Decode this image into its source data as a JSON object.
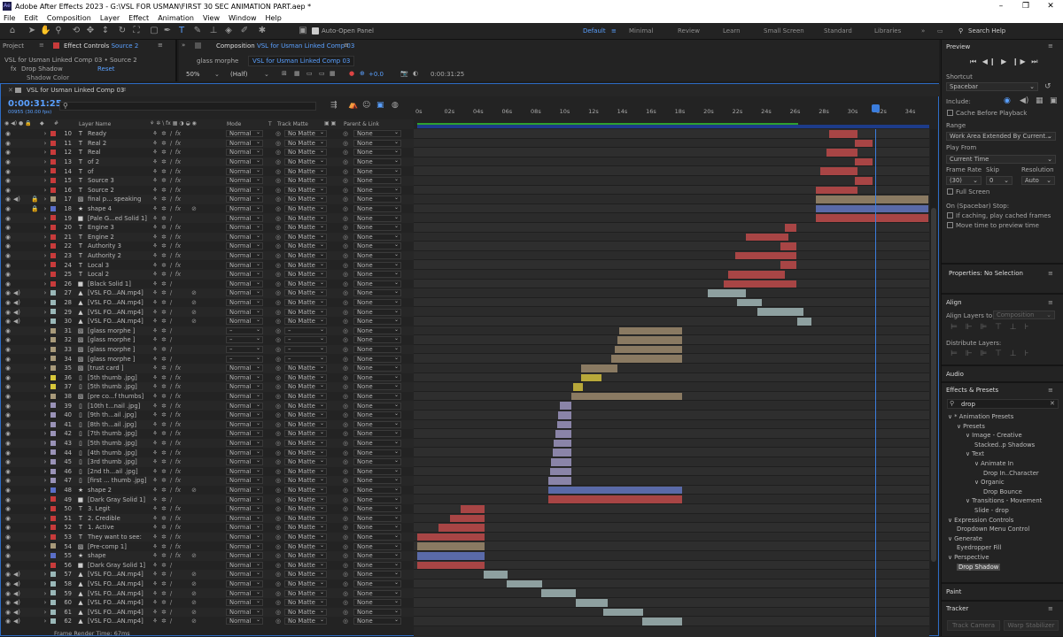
{
  "window": {
    "title": "Adobe After Effects 2023 - G:\\VSL FOR USMAN\\FIRST 30 SEC ANIMATION PART.aep *",
    "minimize": "–",
    "maximize": "❐",
    "close": "✕"
  },
  "menu": [
    "File",
    "Edit",
    "Composition",
    "Layer",
    "Effect",
    "Animation",
    "View",
    "Window",
    "Help"
  ],
  "toolbar": {
    "auto_open": "Auto-Open Panel",
    "workspaces": [
      "Default",
      "Minimal",
      "Review",
      "Learn",
      "Small Screen",
      "Standard",
      "Libraries"
    ],
    "search": "Search Help"
  },
  "left_panel": {
    "project_tab": "Project",
    "effect_tab": "Effect Controls",
    "effect_target": "Source 2",
    "layer_path": "VSL for Usman Linked Comp 03 • Source 2",
    "effect_name": "Drop Shadow",
    "reset": "Reset",
    "prop": "Shadow Color"
  },
  "comp_panel": {
    "tab_label": "Composition",
    "comp_name": "VSL for Usman Linked Comp 03",
    "breadcrumb_1": "glass morphe",
    "breadcrumb_2": "VSL for Usman Linked Comp 03",
    "zoom": "50%",
    "res": "(Half)",
    "exposure": "+0.0",
    "timecode": "0:00:31:25"
  },
  "timeline": {
    "tab": "VSL for Usman Linked Comp 03",
    "timecode": "0:00:31:25",
    "sub": "00955 (30.00 fps)",
    "search_placeholder": "",
    "col_layer_name": "Layer Name",
    "col_mode": "Mode",
    "col_t": "T",
    "col_trackmatte": "Track Matte",
    "col_parent": "Parent & Link",
    "ruler": [
      "0s",
      "02s",
      "04s",
      "06s",
      "08s",
      "10s",
      "12s",
      "14s",
      "16s",
      "18s",
      "20s",
      "22s",
      "24s",
      "26s",
      "28s",
      "30s",
      "32s",
      "34s"
    ],
    "status": "Frame Render Time: 67ms"
  },
  "layers": [
    {
      "n": "10",
      "name": "Ready",
      "t": "T",
      "color": "#c83b3b",
      "mode": "Normal",
      "tm": "No Matte",
      "parent": "None",
      "fx": true
    },
    {
      "n": "11",
      "name": "Real 2",
      "t": "T",
      "color": "#c83b3b",
      "mode": "Normal",
      "tm": "No Matte",
      "parent": "None",
      "fx": true
    },
    {
      "n": "12",
      "name": "Real",
      "t": "T",
      "color": "#c83b3b",
      "mode": "Normal",
      "tm": "No Matte",
      "parent": "None",
      "fx": true
    },
    {
      "n": "13",
      "name": "of 2",
      "t": "T",
      "color": "#c83b3b",
      "mode": "Normal",
      "tm": "No Matte",
      "parent": "None",
      "fx": true
    },
    {
      "n": "14",
      "name": "of",
      "t": "T",
      "color": "#c83b3b",
      "mode": "Normal",
      "tm": "No Matte",
      "parent": "None",
      "fx": true
    },
    {
      "n": "15",
      "name": "Source 3",
      "t": "T",
      "color": "#c83b3b",
      "mode": "Normal",
      "tm": "No Matte",
      "parent": "None",
      "fx": true
    },
    {
      "n": "16",
      "name": "Source 2",
      "t": "T",
      "color": "#c83b3b",
      "mode": "Normal",
      "tm": "No Matte",
      "parent": "None",
      "fx": true
    },
    {
      "n": "17",
      "name": "final p... speaking",
      "t": "img",
      "color": "#a89a7a",
      "mode": "Normal",
      "tm": "No Matte",
      "parent": "None",
      "fx": true
    },
    {
      "n": "18",
      "name": "shape 4",
      "t": "star",
      "color": "#5a6fc8",
      "mode": "Normal",
      "tm": "No Matte",
      "parent": "None",
      "fx": true
    },
    {
      "n": "19",
      "name": "[Pale G...ed Solid 1]",
      "t": "sq",
      "color": "#c83b3b",
      "mode": "Normal",
      "tm": "No Matte",
      "parent": "None",
      "fx": false
    },
    {
      "n": "20",
      "name": "Engine 3",
      "t": "T",
      "color": "#c83b3b",
      "mode": "Normal",
      "tm": "No Matte",
      "parent": "None",
      "fx": true
    },
    {
      "n": "21",
      "name": "Engine 2",
      "t": "T",
      "color": "#c83b3b",
      "mode": "Normal",
      "tm": "No Matte",
      "parent": "None",
      "fx": true
    },
    {
      "n": "22",
      "name": "Authority 3",
      "t": "T",
      "color": "#c83b3b",
      "mode": "Normal",
      "tm": "No Matte",
      "parent": "None",
      "fx": true
    },
    {
      "n": "23",
      "name": "Authority 2",
      "t": "T",
      "color": "#c83b3b",
      "mode": "Normal",
      "tm": "No Matte",
      "parent": "None",
      "fx": true
    },
    {
      "n": "24",
      "name": "Local 3",
      "t": "T",
      "color": "#c83b3b",
      "mode": "Normal",
      "tm": "No Matte",
      "parent": "None",
      "fx": true
    },
    {
      "n": "25",
      "name": "Local 2",
      "t": "T",
      "color": "#c83b3b",
      "mode": "Normal",
      "tm": "No Matte",
      "parent": "None",
      "fx": true
    },
    {
      "n": "26",
      "name": "[Black Solid 1]",
      "t": "sq",
      "color": "#c83b3b",
      "mode": "Normal",
      "tm": "No Matte",
      "parent": "None",
      "fx": false
    },
    {
      "n": "27",
      "name": "[VSL FO...AN.mp4]",
      "t": "vid",
      "color": "#9ab8b8",
      "mode": "Normal",
      "tm": "No Matte",
      "parent": "None",
      "fx": false
    },
    {
      "n": "28",
      "name": "[VSL FO...AN.mp4]",
      "t": "vid",
      "color": "#9ab8b8",
      "mode": "Normal",
      "tm": "No Matte",
      "parent": "None",
      "fx": false
    },
    {
      "n": "29",
      "name": "[VSL FO...AN.mp4]",
      "t": "vid",
      "color": "#9ab8b8",
      "mode": "Normal",
      "tm": "No Matte",
      "parent": "None",
      "fx": false
    },
    {
      "n": "30",
      "name": "[VSL FO...AN.mp4]",
      "t": "vid",
      "color": "#9ab8b8",
      "mode": "Normal",
      "tm": "No Matte",
      "parent": "None",
      "fx": false
    },
    {
      "n": "31",
      "name": "[glass morphe ]",
      "t": "img",
      "color": "#a89a7a",
      "mode": "–",
      "tm": "–",
      "parent": "None",
      "fx": false
    },
    {
      "n": "32",
      "name": "[glass morphe ]",
      "t": "img",
      "color": "#a89a7a",
      "mode": "–",
      "tm": "–",
      "parent": "None",
      "fx": false
    },
    {
      "n": "33",
      "name": "[glass morphe ]",
      "t": "img",
      "color": "#a89a7a",
      "mode": "–",
      "tm": "–",
      "parent": "None",
      "fx": false
    },
    {
      "n": "34",
      "name": "[glass morphe ]",
      "t": "img",
      "color": "#a89a7a",
      "mode": "–",
      "tm": "–",
      "parent": "None",
      "fx": false
    },
    {
      "n": "35",
      "name": "[trust card ]",
      "t": "img",
      "color": "#a89a7a",
      "mode": "Normal",
      "tm": "No Matte",
      "parent": "None",
      "fx": true
    },
    {
      "n": "36",
      "name": "[5th thumb .jpg]",
      "t": "file",
      "color": "#d8c83a",
      "mode": "Normal",
      "tm": "No Matte",
      "parent": "None",
      "fx": true
    },
    {
      "n": "37",
      "name": "[5th thumb .jpg]",
      "t": "file",
      "color": "#d8c83a",
      "mode": "Normal",
      "tm": "No Matte",
      "parent": "None",
      "fx": true
    },
    {
      "n": "38",
      "name": "[pre co...f thumbs]",
      "t": "img",
      "color": "#a89a7a",
      "mode": "Normal",
      "tm": "No Matte",
      "parent": "None",
      "fx": true
    },
    {
      "n": "39",
      "name": "[10th t...nail .jpg]",
      "t": "file",
      "color": "#9a93b8",
      "mode": "Normal",
      "tm": "No Matte",
      "parent": "None",
      "fx": true
    },
    {
      "n": "40",
      "name": "[9th th...ail .jpg]",
      "t": "file",
      "color": "#9a93b8",
      "mode": "Normal",
      "tm": "No Matte",
      "parent": "None",
      "fx": true
    },
    {
      "n": "41",
      "name": "[8th th...ail .jpg]",
      "t": "file",
      "color": "#9a93b8",
      "mode": "Normal",
      "tm": "No Matte",
      "parent": "None",
      "fx": true
    },
    {
      "n": "42",
      "name": "[7th thumb .jpg]",
      "t": "file",
      "color": "#9a93b8",
      "mode": "Normal",
      "tm": "No Matte",
      "parent": "None",
      "fx": true
    },
    {
      "n": "43",
      "name": "[5th thumb .jpg]",
      "t": "file",
      "color": "#9a93b8",
      "mode": "Normal",
      "tm": "No Matte",
      "parent": "None",
      "fx": true
    },
    {
      "n": "44",
      "name": "[4th thumb .jpg]",
      "t": "file",
      "color": "#9a93b8",
      "mode": "Normal",
      "tm": "No Matte",
      "parent": "None",
      "fx": true
    },
    {
      "n": "45",
      "name": "[3rd thumb .jpg]",
      "t": "file",
      "color": "#9a93b8",
      "mode": "Normal",
      "tm": "No Matte",
      "parent": "None",
      "fx": true
    },
    {
      "n": "46",
      "name": "[2nd th...ail .jpg]",
      "t": "file",
      "color": "#9a93b8",
      "mode": "Normal",
      "tm": "No Matte",
      "parent": "None",
      "fx": true
    },
    {
      "n": "47",
      "name": "[first ... thumb .jpg]",
      "t": "file",
      "color": "#9a93b8",
      "mode": "Normal",
      "tm": "No Matte",
      "parent": "None",
      "fx": true
    },
    {
      "n": "48",
      "name": "shape 2",
      "t": "star",
      "color": "#5a6fc8",
      "mode": "Normal",
      "tm": "No Matte",
      "parent": "None",
      "fx": true
    },
    {
      "n": "49",
      "name": "[Dark Gray Solid 1]",
      "t": "sq",
      "color": "#c83b3b",
      "mode": "Normal",
      "tm": "No Matte",
      "parent": "None",
      "fx": false
    },
    {
      "n": "50",
      "name": "3. Legit",
      "t": "T",
      "color": "#c83b3b",
      "mode": "Normal",
      "tm": "No Matte",
      "parent": "None",
      "fx": true
    },
    {
      "n": "51",
      "name": "2. Credible",
      "t": "T",
      "color": "#c83b3b",
      "mode": "Normal",
      "tm": "No Matte",
      "parent": "None",
      "fx": true
    },
    {
      "n": "52",
      "name": "1. Active",
      "t": "T",
      "color": "#c83b3b",
      "mode": "Normal",
      "tm": "No Matte",
      "parent": "None",
      "fx": true
    },
    {
      "n": "53",
      "name": "They want to see:",
      "t": "T",
      "color": "#c83b3b",
      "mode": "Normal",
      "tm": "No Matte",
      "parent": "None",
      "fx": true
    },
    {
      "n": "54",
      "name": "[Pre-comp 1]",
      "t": "img",
      "color": "#a89a7a",
      "mode": "Normal",
      "tm": "No Matte",
      "parent": "None",
      "fx": true
    },
    {
      "n": "55",
      "name": "shape",
      "t": "star",
      "color": "#5a6fc8",
      "mode": "Normal",
      "tm": "No Matte",
      "parent": "None",
      "fx": true
    },
    {
      "n": "56",
      "name": "[Dark Gray Solid 1]",
      "t": "sq",
      "color": "#c83b3b",
      "mode": "Normal",
      "tm": "No Matte",
      "parent": "None",
      "fx": false
    },
    {
      "n": "57",
      "name": "[VSL FO...AN.mp4]",
      "t": "vid",
      "color": "#9ab8b8",
      "mode": "Normal",
      "tm": "No Matte",
      "parent": "None",
      "fx": false
    },
    {
      "n": "58",
      "name": "[VSL FO...AN.mp4]",
      "t": "vid",
      "color": "#9ab8b8",
      "mode": "Normal",
      "tm": "No Matte",
      "parent": "None",
      "fx": false
    },
    {
      "n": "59",
      "name": "[VSL FO...AN.mp4]",
      "t": "vid",
      "color": "#9ab8b8",
      "mode": "Normal",
      "tm": "No Matte",
      "parent": "None",
      "fx": false
    },
    {
      "n": "60",
      "name": "[VSL FO...AN.mp4]",
      "t": "vid",
      "color": "#9ab8b8",
      "mode": "Normal",
      "tm": "No Matte",
      "parent": "None",
      "fx": false
    },
    {
      "n": "61",
      "name": "[VSL FO...AN.mp4]",
      "t": "vid",
      "color": "#9ab8b8",
      "mode": "Normal",
      "tm": "No Matte",
      "parent": "None",
      "fx": false
    },
    {
      "n": "62",
      "name": "[VSL FO...AN.mp4]",
      "t": "vid",
      "color": "#9ab8b8",
      "mode": "Normal",
      "tm": "No Matte",
      "parent": "None",
      "fx": false
    }
  ],
  "tracks": [
    {
      "start": 28.6,
      "end": 30.6,
      "color": "#a84545"
    },
    {
      "start": 30.4,
      "end": 31.6,
      "color": "#a84545"
    },
    {
      "start": 28.4,
      "end": 30.6,
      "color": "#a84545"
    },
    {
      "start": 30.4,
      "end": 31.6,
      "color": "#a84545"
    },
    {
      "start": 28.0,
      "end": 30.6,
      "color": "#a84545"
    },
    {
      "start": 30.4,
      "end": 31.6,
      "color": "#a84545"
    },
    {
      "start": 27.7,
      "end": 30.6,
      "color": "#a84545"
    },
    {
      "start": 27.7,
      "end": 35.5,
      "color": "#8a7a62"
    },
    {
      "start": 27.7,
      "end": 35.5,
      "color": "#5a6aa8"
    },
    {
      "start": 27.7,
      "end": 35.5,
      "color": "#a84545"
    },
    {
      "start": 25.5,
      "end": 26.3,
      "color": "#a84545"
    },
    {
      "start": 22.8,
      "end": 25.8,
      "color": "#a84545"
    },
    {
      "start": 25.2,
      "end": 26.3,
      "color": "#a84545"
    },
    {
      "start": 22.1,
      "end": 26.3,
      "color": "#a84545"
    },
    {
      "start": 25.2,
      "end": 26.3,
      "color": "#a84545"
    },
    {
      "start": 21.6,
      "end": 25.5,
      "color": "#a84545"
    },
    {
      "start": 21.3,
      "end": 26.3,
      "color": "#a84545"
    },
    {
      "start": 20.2,
      "end": 22.8,
      "color": "#8ea0a0"
    },
    {
      "start": 22.2,
      "end": 23.9,
      "color": "#8ea0a0"
    },
    {
      "start": 23.6,
      "end": 26.8,
      "color": "#8ea0a0"
    },
    {
      "start": 26.4,
      "end": 27.4,
      "color": "#8ea0a0"
    },
    {
      "start": 14.0,
      "end": 18.4,
      "color": "#8a7a62"
    },
    {
      "start": 13.9,
      "end": 18.4,
      "color": "#8a7a62"
    },
    {
      "start": 13.7,
      "end": 18.4,
      "color": "#8a7a62"
    },
    {
      "start": 13.5,
      "end": 18.4,
      "color": "#8a7a62"
    },
    {
      "start": 11.4,
      "end": 13.9,
      "color": "#8a7a62"
    },
    {
      "start": 11.4,
      "end": 12.8,
      "color": "#b8a83a"
    },
    {
      "start": 10.8,
      "end": 11.5,
      "color": "#b8a83a"
    },
    {
      "start": 10.7,
      "end": 18.4,
      "color": "#8a7a62"
    },
    {
      "start": 9.9,
      "end": 10.7,
      "color": "#8a84a8"
    },
    {
      "start": 9.8,
      "end": 10.7,
      "color": "#8a84a8"
    },
    {
      "start": 9.7,
      "end": 10.7,
      "color": "#8a84a8"
    },
    {
      "start": 9.6,
      "end": 10.7,
      "color": "#8a84a8"
    },
    {
      "start": 9.5,
      "end": 10.7,
      "color": "#8a84a8"
    },
    {
      "start": 9.4,
      "end": 10.7,
      "color": "#8a84a8"
    },
    {
      "start": 9.3,
      "end": 10.7,
      "color": "#8a84a8"
    },
    {
      "start": 9.2,
      "end": 10.7,
      "color": "#8a84a8"
    },
    {
      "start": 9.1,
      "end": 10.7,
      "color": "#8a84a8"
    },
    {
      "start": 9.1,
      "end": 18.4,
      "color": "#5a6aa8"
    },
    {
      "start": 9.1,
      "end": 18.4,
      "color": "#a84545"
    },
    {
      "start": 3.0,
      "end": 4.7,
      "color": "#a84545"
    },
    {
      "start": 2.3,
      "end": 4.7,
      "color": "#a84545"
    },
    {
      "start": 1.5,
      "end": 4.7,
      "color": "#a84545"
    },
    {
      "start": 0.0,
      "end": 4.7,
      "color": "#a84545"
    },
    {
      "start": 0.0,
      "end": 4.7,
      "color": "#8a7a62"
    },
    {
      "start": 0.0,
      "end": 4.7,
      "color": "#5a6aa8"
    },
    {
      "start": 0.0,
      "end": 4.7,
      "color": "#a84545"
    },
    {
      "start": 4.6,
      "end": 6.3,
      "color": "#8ea0a0"
    },
    {
      "start": 6.2,
      "end": 8.7,
      "color": "#8ea0a0"
    },
    {
      "start": 8.6,
      "end": 11.0,
      "color": "#8ea0a0"
    },
    {
      "start": 11.0,
      "end": 13.2,
      "color": "#8ea0a0"
    },
    {
      "start": 12.9,
      "end": 15.7,
      "color": "#8ea0a0"
    },
    {
      "start": 15.6,
      "end": 18.4,
      "color": "#8ea0a0"
    }
  ],
  "playhead_seconds": 31.8,
  "right_panel": {
    "preview": "Preview",
    "shortcut_label": "Shortcut",
    "shortcut_value": "Spacebar",
    "include": "Include:",
    "cache_before": "Cache Before Playback",
    "range_label": "Range",
    "range_value": "Work Area Extended By Current...",
    "play_from_label": "Play From",
    "play_from_value": "Current Time",
    "fr_label": "Frame Rate",
    "skip_label": "Skip",
    "res_label": "Resolution",
    "fr_value": "(30)",
    "skip_value": "0",
    "res_value": "Auto",
    "full_screen": "Full Screen",
    "on_stop": "On (Spacebar) Stop:",
    "if_caching": "If caching, play cached frames",
    "move_time": "Move time to preview time",
    "properties": "Properties: No Selection",
    "align": "Align",
    "align_to": "Align Layers to:",
    "align_to_value": "Composition",
    "distribute": "Distribute Layers:",
    "audio": "Audio",
    "effects": "Effects & Presets",
    "effects_search": "drop",
    "tree": [
      {
        "d": 0,
        "t": "∨ * Animation Presets"
      },
      {
        "d": 1,
        "t": "∨ Presets"
      },
      {
        "d": 2,
        "t": "∨ Image - Creative"
      },
      {
        "d": 3,
        "t": "Stacked..p Shadows"
      },
      {
        "d": 2,
        "t": "∨ Text"
      },
      {
        "d": 3,
        "t": "∨ Animate In"
      },
      {
        "d": 4,
        "t": "Drop In..Character"
      },
      {
        "d": 3,
        "t": "∨ Organic"
      },
      {
        "d": 4,
        "t": "Drop Bounce"
      },
      {
        "d": 2,
        "t": "∨ Transitions - Movement"
      },
      {
        "d": 3,
        "t": "Slide - drop"
      },
      {
        "d": 0,
        "t": "∨ Expression Controls"
      },
      {
        "d": 1,
        "t": "Dropdown Menu Control"
      },
      {
        "d": 0,
        "t": "∨ Generate"
      },
      {
        "d": 1,
        "t": "Eyedropper Fill"
      },
      {
        "d": 0,
        "t": "∨ Perspective"
      },
      {
        "d": 1,
        "t": "Drop Shadow"
      }
    ],
    "paint": "Paint",
    "tracker": "Tracker",
    "track_camera": "Track Camera",
    "warp_stabilizer": "Warp Stabilizer"
  }
}
